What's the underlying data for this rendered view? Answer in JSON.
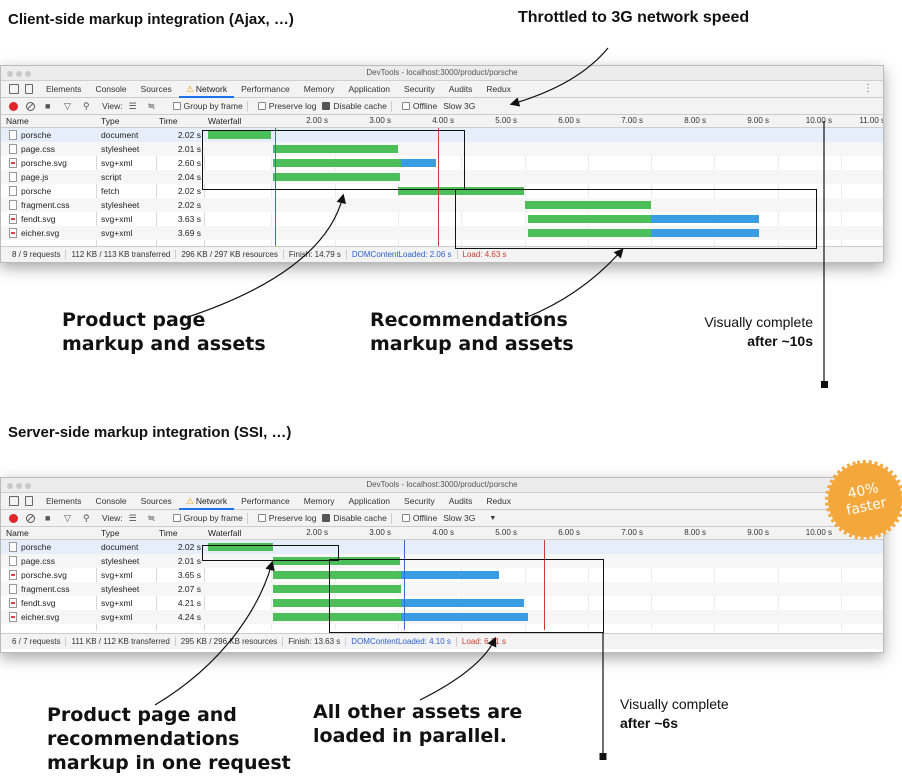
{
  "headings": {
    "client": "Client-side markup integration (Ajax, …)",
    "throttled": "Throttled to 3G network speed",
    "server": "Server-side markup integration (SSI, …)"
  },
  "callouts": {
    "product_top": [
      "Product page",
      "markup and assets"
    ],
    "reco_top": [
      "Recommendations",
      "markup and assets"
    ],
    "visual_top": [
      "Visually complete",
      "after ~10s"
    ],
    "product_bottom": [
      "Product page and",
      "recommendations",
      "markup in one request"
    ],
    "parallel_bottom": [
      "All other assets are",
      "loaded in parallel."
    ],
    "visual_bottom": [
      "Visually complete",
      "after ~6s"
    ]
  },
  "badge": [
    "40%",
    "faster"
  ],
  "devtools": {
    "window_title": "DevTools - localhost:3000/product/porsche",
    "tabs": [
      "Elements",
      "Console",
      "Sources",
      "Network",
      "Performance",
      "Memory",
      "Application",
      "Security",
      "Audits",
      "Redux"
    ],
    "active_tab": "Network",
    "toolbar": {
      "view_label": "View:",
      "group_by_frame": "Group by frame",
      "preserve_log": "Preserve log",
      "disable_cache": "Disable cache",
      "offline": "Offline",
      "throttle": "Slow 3G"
    },
    "columns": [
      "Name",
      "Type",
      "Time",
      "Waterfall"
    ],
    "ticks": [
      "2.00 s",
      "3.00 s",
      "4.00 s",
      "5.00 s",
      "6.00 s",
      "7.00 s",
      "8.00 s",
      "9.00 s",
      "10.00 s",
      "11.00 s"
    ]
  },
  "client_panel": {
    "rows": [
      {
        "name": "porsche",
        "type": "document",
        "time": "2.02 s"
      },
      {
        "name": "page.css",
        "type": "stylesheet",
        "time": "2.01 s"
      },
      {
        "name": "porsche.svg",
        "type": "svg+xml",
        "time": "2.60 s"
      },
      {
        "name": "page.js",
        "type": "script",
        "time": "2.04 s"
      },
      {
        "name": "porsche",
        "type": "fetch",
        "time": "2.02 s"
      },
      {
        "name": "fragment.css",
        "type": "stylesheet",
        "time": "2.02 s"
      },
      {
        "name": "fendt.svg",
        "type": "svg+xml",
        "time": "3.63 s"
      },
      {
        "name": "eicher.svg",
        "type": "svg+xml",
        "time": "3.69 s"
      }
    ],
    "status": {
      "requests": "8 / 9 requests",
      "transferred": "112 KB / 113 KB transferred",
      "resources": "296 KB / 297 KB resources",
      "finish": "Finish: 14.79 s",
      "dcl": "DOMContentLoaded: 2.06 s",
      "load": "Load: 4.63 s"
    }
  },
  "server_panel": {
    "rows": [
      {
        "name": "porsche",
        "type": "document",
        "time": "2.02 s"
      },
      {
        "name": "page.css",
        "type": "stylesheet",
        "time": "2.01 s"
      },
      {
        "name": "porsche.svg",
        "type": "svg+xml",
        "time": "3.65 s"
      },
      {
        "name": "fragment.css",
        "type": "stylesheet",
        "time": "2.07 s"
      },
      {
        "name": "fendt.svg",
        "type": "svg+xml",
        "time": "4.21 s"
      },
      {
        "name": "eicher.svg",
        "type": "svg+xml",
        "time": "4.24 s"
      }
    ],
    "status": {
      "requests": "6 / 7 requests",
      "transferred": "111 KB / 112 KB transferred",
      "resources": "295 KB / 296 KB resources",
      "finish": "Finish: 13.63 s",
      "dcl": "DOMContentLoaded: 4.10 s",
      "load": "Load: 6.31 s"
    }
  }
}
